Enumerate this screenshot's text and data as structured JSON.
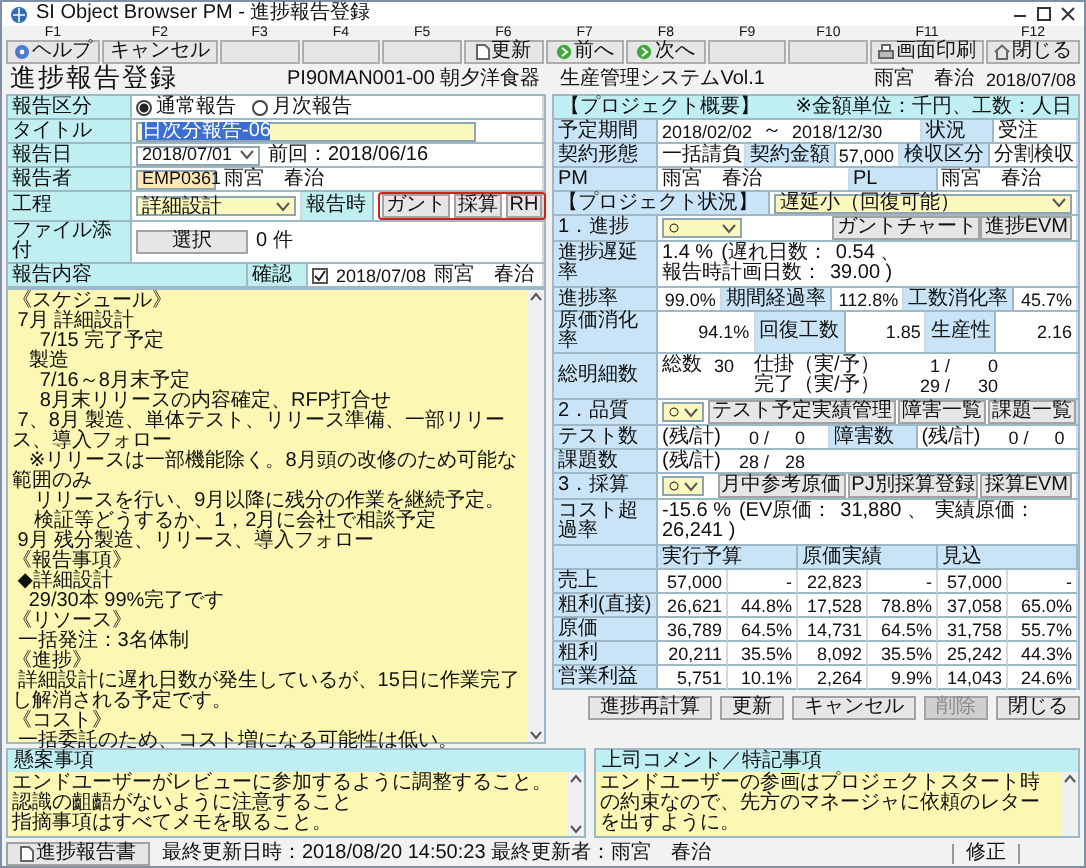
{
  "window": {
    "title": "SI Object Browser PM - 進捗報告登録"
  },
  "function_keys": [
    {
      "key": "F1",
      "label": "ヘルプ"
    },
    {
      "key": "F2",
      "label": "キャンセル"
    },
    {
      "key": "F3"
    },
    {
      "key": "F4"
    },
    {
      "key": "F5"
    },
    {
      "key": "F6",
      "label": "更新"
    },
    {
      "key": "F7",
      "label": "前へ"
    },
    {
      "key": "F8",
      "label": "次へ"
    },
    {
      "key": "F9"
    },
    {
      "key": "F10"
    },
    {
      "key": "F11",
      "label": "画面印刷"
    },
    {
      "key": "F12",
      "label": "閉じる"
    }
  ],
  "header": {
    "title": "進捗報告登録",
    "project": "PI90MAN001-00 朝夕洋食器　生産管理システムVol.1",
    "user": "雨宮　春治",
    "date": "2018/07/08"
  },
  "report": {
    "type": {
      "label": "報告区分",
      "options": [
        {
          "label": "通常報告",
          "selected": true
        },
        {
          "label": "月次報告",
          "selected": false
        }
      ]
    },
    "title": {
      "label": "タイトル",
      "value": "日次分報告-06",
      "highlighted": true
    },
    "date": {
      "label": "報告日",
      "value": "2018/07/01",
      "previous": "前回：2018/06/16"
    },
    "reporter": {
      "label": "報告者",
      "id": "EMP0361",
      "name": "雨宮　春治"
    },
    "process": {
      "label": "工程",
      "value": "詳細設計",
      "time_label": "報告時",
      "buttons": [
        "ガント",
        "採算",
        "RH"
      ]
    },
    "attachment": {
      "label": "ファイル添付",
      "button": "選択",
      "count": "0 件"
    },
    "content": {
      "label": "報告内容",
      "confirm_label": "確認",
      "confirmed": true,
      "confirm_date": "2018/07/08",
      "confirm_user": "雨宮　春治",
      "sections": [
        [
          "《スケジュール》",
          " 7月 詳細設計",
          "     7/15 完了予定",
          "   製造",
          "     7/16～8月末予定",
          "     8月末リリースの内容確定、RFP打合せ",
          " 7、8月 製造、単体テスト、リリース準備、一部リリース、導入フォロー",
          "   ※リリースは一部機能除く。8月頭の改修のため可能な範囲のみ",
          "    リリースを行い、9月以降に残分の作業を継続予定。",
          "    検証等どうするか、1，2月に会社で相談予定",
          " 9月 残分製造、リリース、導入フォロー"
        ],
        [
          "《報告事項》",
          " ◆詳細設計",
          "   29/30本 99%完了です"
        ],
        [
          "《リソース》",
          " 一括発注：3名体制"
        ],
        [
          "《進捗》",
          " 詳細設計に遅れ日数が発生しているが、15日に作業完了し解消される予定です。"
        ],
        [
          "《コスト》",
          " 一括委託のため、コスト増になる可能性は低い。"
        ]
      ]
    },
    "concerns": {
      "label": "懸案事項",
      "lines": [
        "エンドユーザーがレビューに参加するように調整すること。",
        "認識の齟齬がないように注意すること",
        "指摘事項はすべてメモを取ること。"
      ]
    },
    "comments": {
      "label": "上司コメント／特記事項",
      "text": "エンドユーザーの参画はプロジェクトスタート時の約束なので、先方のマネージャに依頼のレターを出すように。"
    },
    "report_button": "進捗報告書"
  },
  "overview": {
    "title": "【プロジェクト概要】",
    "unit_note": "※金額単位：千円、工数：人日",
    "period_label": "予定期間",
    "period_start": "2018/02/02",
    "period_sep": "～",
    "period_end": "2018/12/30",
    "status_label": "状況",
    "status": "受注",
    "contract_label": "契約形態",
    "contract": "一括請負",
    "amount_label": "契約金額",
    "amount": "57,000",
    "acceptance_label": "検収区分",
    "acceptance": "分割検収",
    "pm_label": "PM",
    "pm": "雨宮　春治",
    "pl_label": "PL",
    "pl": "雨宮　春治"
  },
  "status": {
    "title": "【プロジェクト状況】",
    "value": "遅延小（回復可能）",
    "progress": {
      "label": "1．進捗",
      "value": "○",
      "buttons": [
        "ガントチャート",
        "進捗EVM"
      ]
    },
    "delay": {
      "label": "進捗遅延率",
      "parts": [
        "1.4 %",
        "(遅れ日数：",
        "0.54 、",
        "報告時計画日数：",
        "39.00 )"
      ]
    },
    "rates": [
      {
        "label": "進捗率",
        "value": "99.0%"
      },
      {
        "label": "期間経過率",
        "value": "112.8%"
      },
      {
        "label": "工数消化率",
        "value": "45.7%"
      }
    ],
    "rates2": [
      {
        "label": "原価消化率",
        "value": "94.1%"
      },
      {
        "label": "回復工数",
        "value": "1.85"
      },
      {
        "label": "生産性",
        "value": "2.16"
      }
    ],
    "details": {
      "label": "総明細数",
      "total_label": "総数",
      "total": "30",
      "rows": [
        {
          "label": "仕掛（実/予）",
          "actual": "1 /",
          "plan": "0"
        },
        {
          "label": "完了（実/予）",
          "actual": "29 /",
          "plan": "30"
        }
      ]
    },
    "quality": {
      "label": "2．品質",
      "value": "○",
      "buttons": [
        "テスト予定実績管理",
        "障害一覧",
        "課題一覧"
      ]
    },
    "tests": {
      "label": "テスト数",
      "unit": "(残/計)",
      "remaining": "0 /",
      "total": "0"
    },
    "defects": {
      "label": "障害数",
      "unit": "(残/計)",
      "remaining": "0 /",
      "total": "0"
    },
    "issues": {
      "label": "課題数",
      "unit": "(残/計)",
      "remaining": "28 /",
      "total": "28"
    },
    "profit": {
      "label": "3．採算",
      "value": "○",
      "buttons": [
        "月中参考原価",
        "PJ別採算登録",
        "採算EVM"
      ]
    },
    "cost": {
      "label": "コスト超過率",
      "parts": [
        "-15.6 %",
        "(EV原価：",
        "31,880 、",
        "実績原価：",
        "26,241 )"
      ]
    }
  },
  "finance": {
    "columns": [
      "実行予算",
      "原価実績",
      "見込"
    ],
    "rows": [
      {
        "label": "売上",
        "values": [
          {
            "amount": "57,000",
            "ratio": "-"
          },
          {
            "amount": "22,823",
            "ratio": "-"
          },
          {
            "amount": "57,000",
            "ratio": "-"
          }
        ]
      },
      {
        "label": "粗利(直接)",
        "values": [
          {
            "amount": "26,621",
            "ratio": "44.8%"
          },
          {
            "amount": "17,528",
            "ratio": "78.8%"
          },
          {
            "amount": "37,058",
            "ratio": "65.0%"
          }
        ]
      },
      {
        "label": "原価",
        "values": [
          {
            "amount": "36,789",
            "ratio": "64.5%"
          },
          {
            "amount": "14,731",
            "ratio": "64.5%"
          },
          {
            "amount": "31,758",
            "ratio": "55.7%"
          }
        ]
      },
      {
        "label": "粗利",
        "values": [
          {
            "amount": "20,211",
            "ratio": "35.5%"
          },
          {
            "amount": "8,092",
            "ratio": "35.5%"
          },
          {
            "amount": "25,242",
            "ratio": "44.3%"
          }
        ]
      },
      {
        "label": "営業利益",
        "values": [
          {
            "amount": "5,751",
            "ratio": "10.1%"
          },
          {
            "amount": "2,264",
            "ratio": "9.9%"
          },
          {
            "amount": "14,043",
            "ratio": "24.6%"
          }
        ]
      }
    ]
  },
  "actions": [
    {
      "label": "進捗再計算",
      "disabled": false
    },
    {
      "label": "更新",
      "disabled": false
    },
    {
      "label": "キャンセル",
      "disabled": false
    },
    {
      "label": "削除",
      "disabled": true
    },
    {
      "label": "閉じる",
      "disabled": false
    }
  ],
  "status_bar": {
    "text": "最終更新日時：2018/08/20 14:50:23 最終更新者：雨宮　春治",
    "mode": "修正"
  }
}
